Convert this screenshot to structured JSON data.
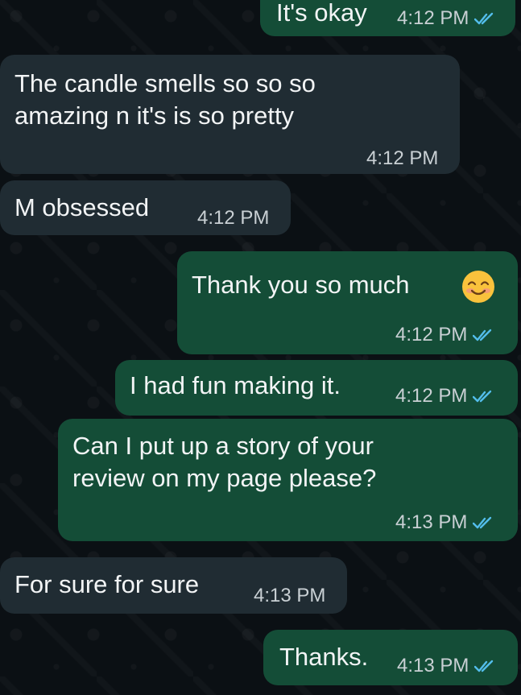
{
  "chat": {
    "messages": [
      {
        "direction": "sent",
        "text": "It's okay",
        "time": "4:12 PM",
        "status": "read"
      },
      {
        "direction": "received",
        "text": "The candle smells so so so\namazing n it's is so pretty",
        "time": "4:12 PM"
      },
      {
        "direction": "received",
        "text": "M obsessed",
        "time": "4:12 PM"
      },
      {
        "direction": "sent",
        "text": "Thank you so much",
        "emoji": "smiling-face-icon",
        "time": "4:12 PM",
        "status": "read"
      },
      {
        "direction": "sent",
        "text": "I had fun making it.",
        "time": "4:12 PM",
        "status": "read"
      },
      {
        "direction": "sent",
        "text": "Can I put up a story of your\nreview on my page please?",
        "time": "4:13 PM",
        "status": "read"
      },
      {
        "direction": "received",
        "text": "For sure for sure",
        "time": "4:13 PM"
      },
      {
        "direction": "sent",
        "text": "Thanks.",
        "time": "4:13 PM",
        "status": "read"
      }
    ]
  },
  "colors": {
    "background": "#0b1014",
    "incoming_bubble": "#202c33",
    "outgoing_bubble": "#144d37",
    "read_tick": "#53bdeb"
  }
}
